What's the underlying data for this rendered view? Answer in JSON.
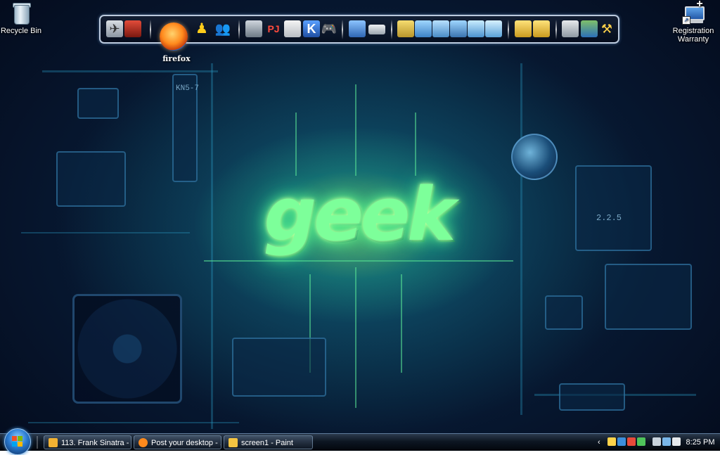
{
  "desktop": {
    "wallpaper_logo": "geek",
    "chip_labels": [
      "KN5-7",
      "2.2.5"
    ],
    "icons": [
      {
        "label": "Recycle Bin",
        "icon": "recycle-bin-icon"
      },
      {
        "label": "Registration Warranty",
        "icon": "registration-warranty-icon"
      }
    ]
  },
  "launcher": {
    "hover_label": "firefox",
    "groups": [
      {
        "items": [
          "airplane-app-icon",
          "red-app-icon"
        ]
      },
      {
        "items": [
          "firefox-icon",
          "aim-icon",
          "messenger-icon"
        ]
      },
      {
        "items": [
          "drive-tool-icon",
          "pdf-tool-icon",
          "disc-icon",
          "k-app-icon",
          "gamepad-icon"
        ]
      },
      {
        "items": [
          "computer-icon",
          "drive-icon"
        ]
      },
      {
        "items": [
          "folder-green-icon",
          "folder-download-icon",
          "folder-music-icon",
          "folder-pictures-icon",
          "folder-documents-icon",
          "folder-video-icon"
        ]
      },
      {
        "items": [
          "folder-yellow-icon",
          "folder-yellow-2-icon"
        ]
      },
      {
        "items": [
          "tools-icon",
          "network-icon",
          "settings-icon"
        ]
      }
    ]
  },
  "taskbar": {
    "tasks": [
      {
        "label": "113. Frank Sinatra - ...",
        "icon": "winamp-icon",
        "color": "#f2b233"
      },
      {
        "label": "Post your desktop - ...",
        "icon": "firefox-icon",
        "color": "#ff8a1d"
      },
      {
        "label": "screen1 - Paint",
        "icon": "paint-icon",
        "color": "#f4c542"
      }
    ],
    "tray_chevron": "‹",
    "clock": "8:25 PM"
  },
  "colors": {
    "glow": "#7dff9a",
    "taskbar": "#0d1622",
    "accent": "#2a7bd1"
  }
}
